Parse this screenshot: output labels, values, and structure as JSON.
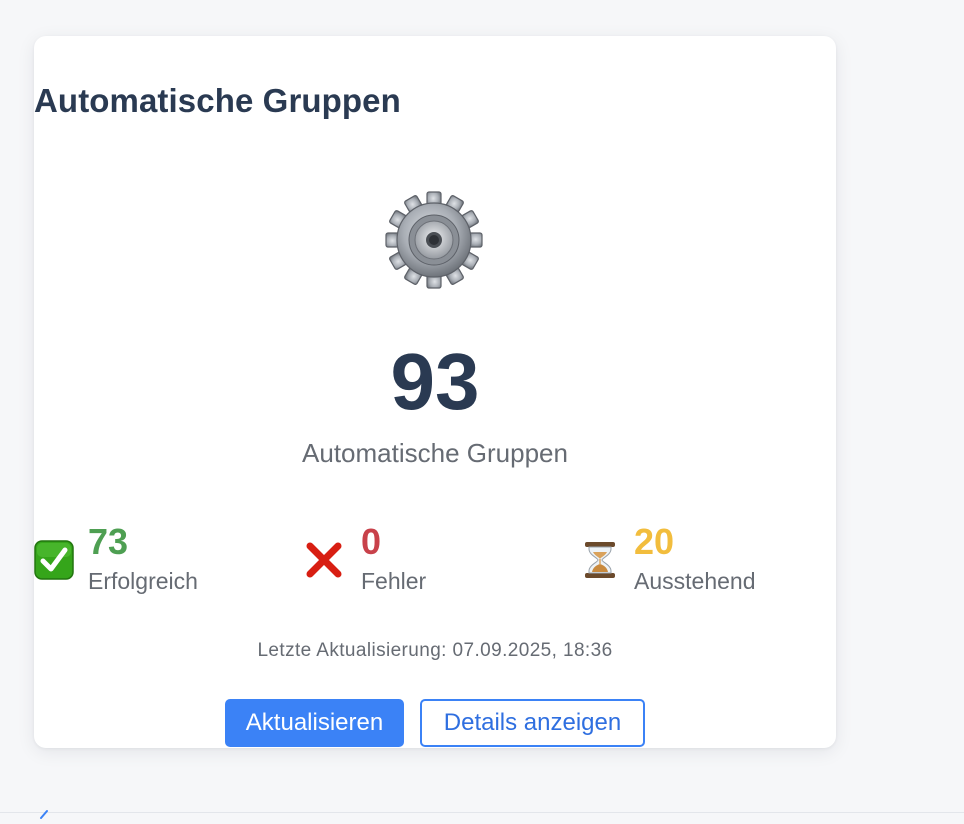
{
  "widget": {
    "title": "Automatische Gruppen",
    "icon": "gear-icon",
    "total": "93",
    "total_label": "Automatische Gruppen"
  },
  "stats": {
    "success": {
      "value": "73",
      "label": "Erfolgreich",
      "icon": "checkmark-icon",
      "color": "#4e9f52"
    },
    "error": {
      "value": "0",
      "label": "Fehler",
      "icon": "cross-icon",
      "color": "#c8414a"
    },
    "pending": {
      "value": "20",
      "label": "Ausstehend",
      "icon": "hourglass-icon",
      "color": "#f2bd3d"
    }
  },
  "last_update": "Letzte Aktualisierung: 07.09.2025, 18:36",
  "buttons": {
    "refresh": "Aktualisieren",
    "details": "Details anzeigen"
  },
  "colors": {
    "accent": "#3b82f6",
    "heading": "#2a3a52",
    "muted": "#666b73"
  }
}
